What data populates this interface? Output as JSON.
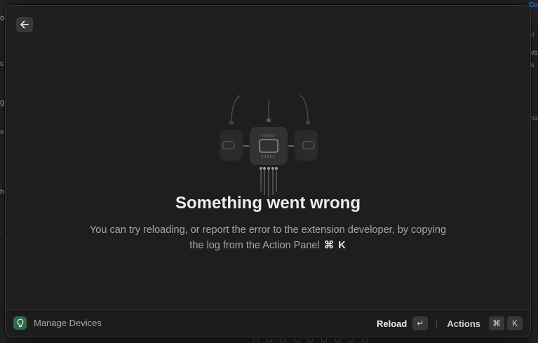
{
  "error": {
    "title": "Something went wrong",
    "description": "You can try reloading, or report the error to the extension developer, by copying the log from the Action Panel",
    "shortcut": "⌘ K"
  },
  "footer": {
    "extension_name": "Manage Devices",
    "primary_action": "Reload",
    "primary_key": "↵",
    "actions_label": "Actions",
    "actions_keys": [
      "⌘",
      "K"
    ]
  },
  "background_fragments": {
    "left": [
      "o",
      "c",
      "g",
      "e",
      "h",
      "."
    ],
    "right": [
      "Co",
      "el",
      "ws",
      "is",
      "eta"
    ]
  },
  "icons": {
    "back": "arrow-left-icon",
    "extension": "lightbulb-icon",
    "illustration": "chip-device-icon"
  },
  "colors": {
    "window_bg": "#1e1e1f",
    "extension_icon_bg": "#2f6b4a",
    "accent_link": "#3a9cf0"
  }
}
